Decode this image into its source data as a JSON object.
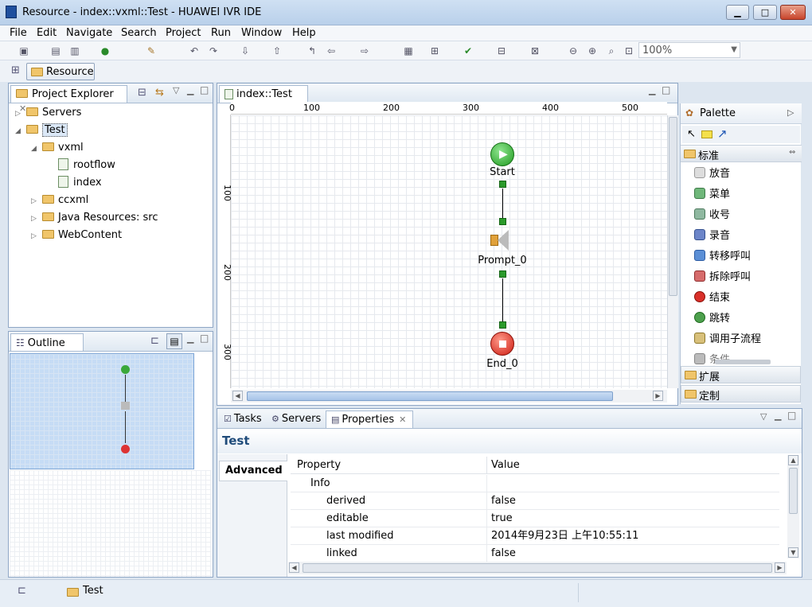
{
  "window": {
    "title": "Resource - index::vxml::Test - HUAWEI IVR IDE",
    "minimize": "▁",
    "maximize": "□",
    "close": "✕"
  },
  "menu": [
    "File",
    "Edit",
    "Navigate",
    "Search",
    "Project",
    "Run",
    "Window",
    "Help"
  ],
  "toolbar": {
    "zoom": "100%"
  },
  "perspective": {
    "label": "Resource"
  },
  "project_explorer": {
    "tab": "Project Explorer",
    "items": [
      "Servers",
      "Test",
      "vxml",
      "rootflow",
      "index",
      "ccxml",
      "Java Resources: src",
      "WebContent"
    ]
  },
  "outline": {
    "tab": "Outline"
  },
  "editor": {
    "tab": "index::Test",
    "ruler_x": [
      "0",
      "100",
      "200",
      "300",
      "400",
      "500"
    ],
    "ruler_y": [
      "100",
      "200",
      "300"
    ],
    "nodes": {
      "start": "Start",
      "prompt": "Prompt_0",
      "end": "End_0"
    }
  },
  "palette": {
    "title": "Palette",
    "group_standard": "标准",
    "items": [
      "放音",
      "菜单",
      "收号",
      "录音",
      "转移呼叫",
      "拆除呼叫",
      "结束",
      "跳转",
      "调用子流程",
      "条件"
    ],
    "group_extend": "扩展",
    "group_custom": "定制"
  },
  "bottom": {
    "tabs": [
      "Tasks",
      "Servers",
      "Properties"
    ],
    "title": "Test",
    "side_tab": "Advanced",
    "col_property": "Property",
    "col_value": "Value",
    "group": "Info",
    "rows": [
      {
        "name": "derived",
        "value": "false"
      },
      {
        "name": "editable",
        "value": "true"
      },
      {
        "name": "last modified",
        "value": "2014年9月23日 上午10:55:11"
      },
      {
        "name": "linked",
        "value": "false"
      }
    ]
  },
  "status": {
    "selected": "Test"
  }
}
